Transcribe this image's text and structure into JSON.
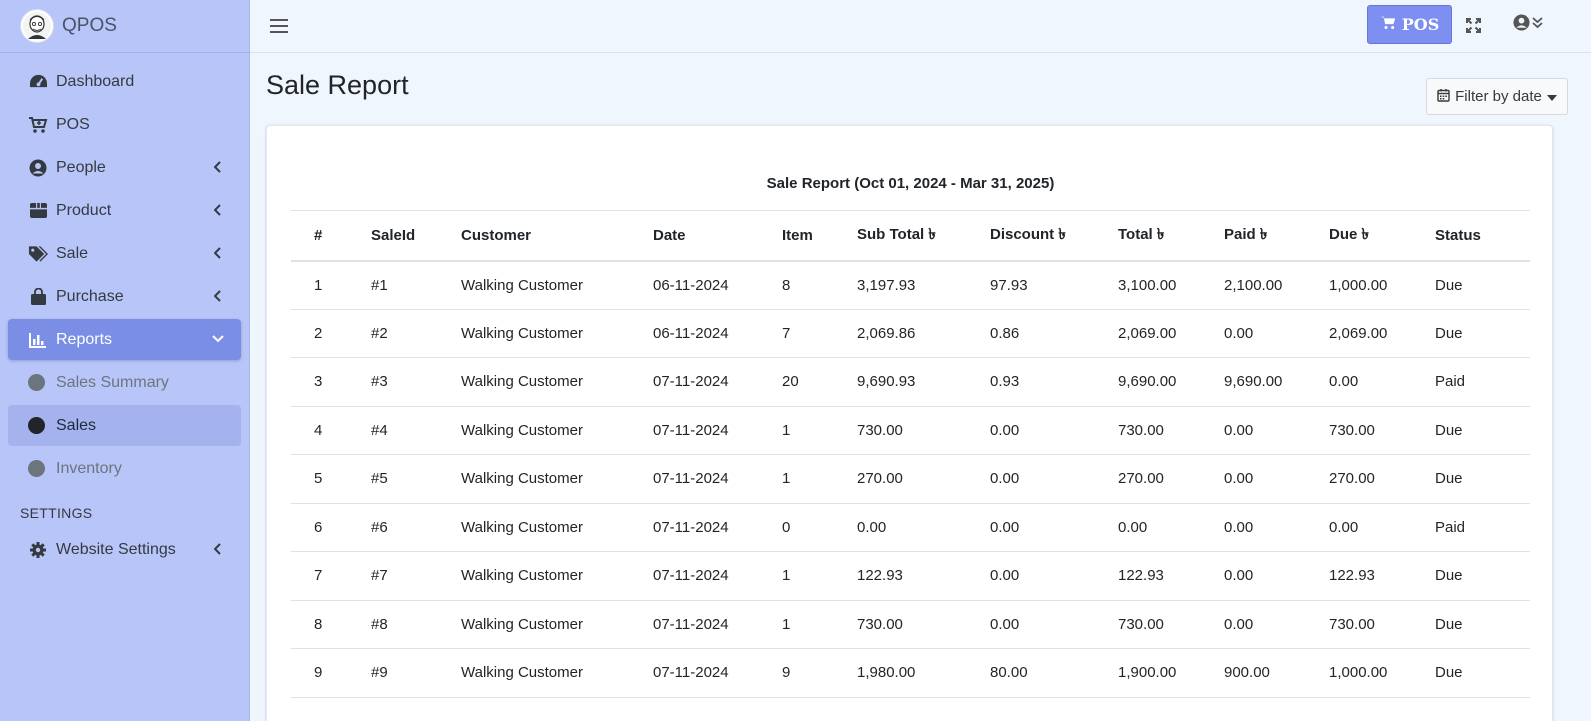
{
  "brand": {
    "name": "QPOS"
  },
  "sidebar": {
    "items": [
      {
        "label": "Dashboard",
        "icon": "tachometer-icon"
      },
      {
        "label": "POS",
        "icon": "cart-plus-icon"
      },
      {
        "label": "People",
        "icon": "user-circle-icon"
      },
      {
        "label": "Product",
        "icon": "box-icon"
      },
      {
        "label": "Sale",
        "icon": "tags-icon"
      },
      {
        "label": "Purchase",
        "icon": "shopping-bag-icon"
      },
      {
        "label": "Reports",
        "icon": "chart-bar-icon"
      }
    ],
    "reports_sub": [
      {
        "label": "Sales Summary"
      },
      {
        "label": "Sales"
      },
      {
        "label": "Inventory"
      }
    ],
    "settings_header": "SETTINGS",
    "website_settings": {
      "label": "Website Settings",
      "icon": "cog-icon"
    }
  },
  "topbar": {
    "pos_button": "POS"
  },
  "page": {
    "title": "Sale Report",
    "filter_button": "Filter by date",
    "report_title": "Sale Report (Oct 01, 2024 - Mar 31, 2025)"
  },
  "table": {
    "headers": [
      "#",
      "SaleId",
      "Customer",
      "Date",
      "Item",
      "Sub Total ৳",
      "Discount ৳",
      "Total ৳",
      "Paid ৳",
      "Due ৳",
      "Status"
    ],
    "rows": [
      [
        "1",
        "#1",
        "Walking Customer",
        "06-11-2024",
        "8",
        "3,197.93",
        "97.93",
        "3,100.00",
        "2,100.00",
        "1,000.00",
        "Due"
      ],
      [
        "2",
        "#2",
        "Walking Customer",
        "06-11-2024",
        "7",
        "2,069.86",
        "0.86",
        "2,069.00",
        "0.00",
        "2,069.00",
        "Due"
      ],
      [
        "3",
        "#3",
        "Walking Customer",
        "07-11-2024",
        "20",
        "9,690.93",
        "0.93",
        "9,690.00",
        "9,690.00",
        "0.00",
        "Paid"
      ],
      [
        "4",
        "#4",
        "Walking Customer",
        "07-11-2024",
        "1",
        "730.00",
        "0.00",
        "730.00",
        "0.00",
        "730.00",
        "Due"
      ],
      [
        "5",
        "#5",
        "Walking Customer",
        "07-11-2024",
        "1",
        "270.00",
        "0.00",
        "270.00",
        "0.00",
        "270.00",
        "Due"
      ],
      [
        "6",
        "#6",
        "Walking Customer",
        "07-11-2024",
        "0",
        "0.00",
        "0.00",
        "0.00",
        "0.00",
        "0.00",
        "Paid"
      ],
      [
        "7",
        "#7",
        "Walking Customer",
        "07-11-2024",
        "1",
        "122.93",
        "0.00",
        "122.93",
        "0.00",
        "122.93",
        "Due"
      ],
      [
        "8",
        "#8",
        "Walking Customer",
        "07-11-2024",
        "1",
        "730.00",
        "0.00",
        "730.00",
        "0.00",
        "730.00",
        "Due"
      ],
      [
        "9",
        "#9",
        "Walking Customer",
        "07-11-2024",
        "9",
        "1,980.00",
        "80.00",
        "1,900.00",
        "900.00",
        "1,000.00",
        "Due"
      ]
    ]
  },
  "colors": {
    "sidebar_bg": "#b8c5f8",
    "active_item": "#7a8ee6",
    "pos_button": "#7d8ff0",
    "page_bg": "#f0f6fd"
  }
}
